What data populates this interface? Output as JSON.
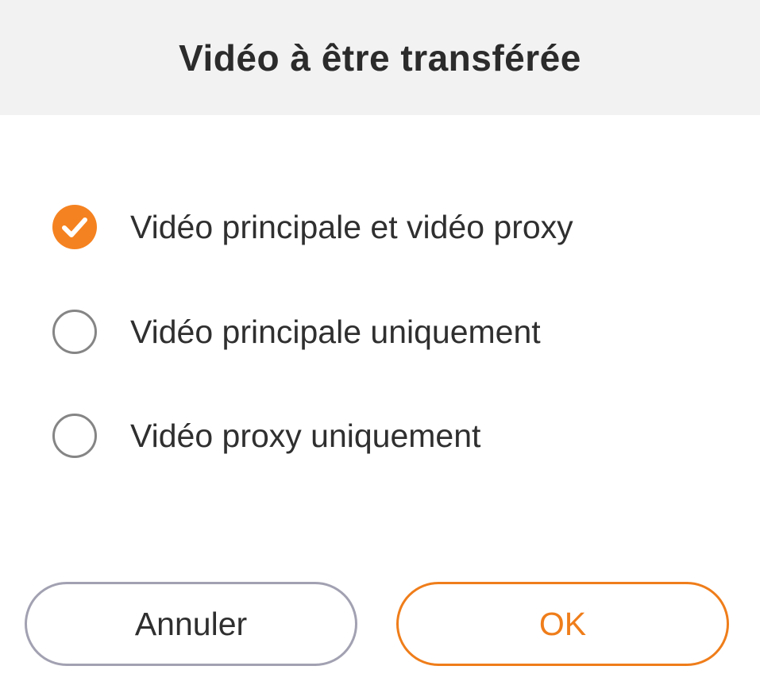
{
  "dialog": {
    "title": "Vidéo à être transférée"
  },
  "options": [
    {
      "label": "Vidéo principale et vidéo proxy",
      "selected": true
    },
    {
      "label": "Vidéo principale uniquement",
      "selected": false
    },
    {
      "label": "Vidéo proxy uniquement",
      "selected": false
    }
  ],
  "buttons": {
    "cancel_label": "Annuler",
    "ok_label": "OK"
  },
  "colors": {
    "accent": "#f58220",
    "ok_text": "#ef7d1a",
    "header_bg": "#f2f2f2",
    "cancel_border": "#a1a1b2",
    "radio_border": "#858585"
  },
  "icons": {
    "selected_radio": "check-icon"
  }
}
